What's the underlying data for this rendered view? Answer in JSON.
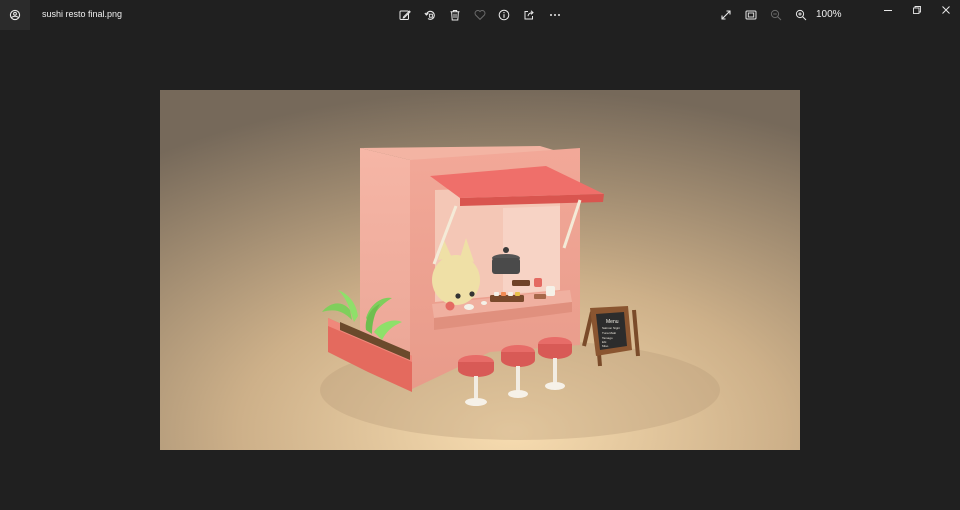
{
  "window": {
    "file_name": "sushi resto final.png"
  },
  "toolbar": {
    "items": [
      {
        "id": "edit",
        "icon": "edit-image-icon"
      },
      {
        "id": "rotate",
        "icon": "rotate-icon"
      },
      {
        "id": "delete",
        "icon": "trash-icon"
      },
      {
        "id": "favorite",
        "icon": "heart-icon"
      },
      {
        "id": "info",
        "icon": "info-icon"
      },
      {
        "id": "share",
        "icon": "share-icon"
      },
      {
        "id": "more",
        "icon": "more-icon"
      }
    ],
    "zoom_level": "100%"
  },
  "image": {
    "menu_board": {
      "title": "Menu",
      "lines": [
        "Salmon Nigiri",
        "Tuna Maki",
        "Tamago",
        "Ebi",
        "Miso"
      ]
    }
  },
  "colors": {
    "background": "#202020",
    "icon": "#e8e8e8",
    "disabled_icon": "#6a6a6a"
  }
}
